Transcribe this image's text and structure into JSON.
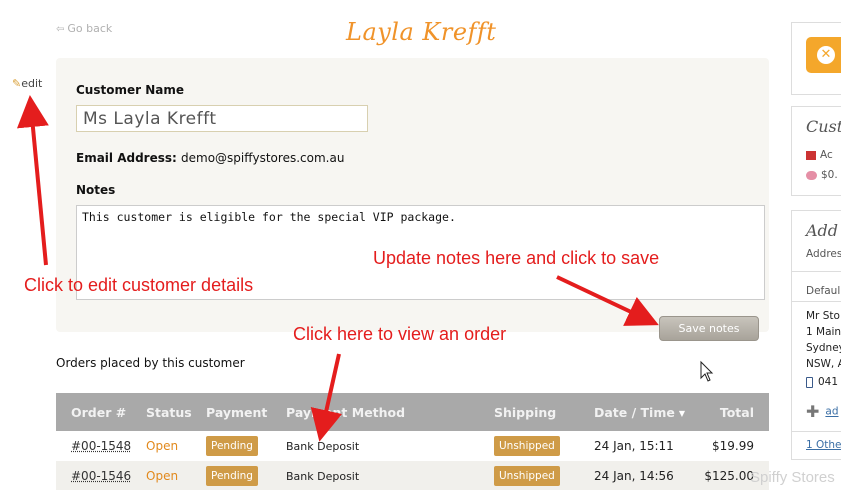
{
  "header": {
    "back_label": "Go back",
    "page_title": "Layla Krefft",
    "edit_label": "edit"
  },
  "customer": {
    "name_label": "Customer Name",
    "name_value": "Ms Layla Krefft",
    "email_label": "Email Address:",
    "email_value": "demo@spiffystores.com.au",
    "notes_label": "Notes",
    "notes_value": "This customer is eligible for the special VIP package.",
    "save_label": "Save notes"
  },
  "annotations": {
    "edit_hint": "Click to edit customer details",
    "notes_hint": "Update notes here and click to save",
    "order_hint": "Click here to view an order"
  },
  "orders": {
    "heading": "Orders placed by this customer",
    "columns": [
      "Order #",
      "Status",
      "Payment",
      "Payment Method",
      "Shipping",
      "Date / Time",
      "Total"
    ],
    "rows": [
      {
        "order": "#00-1548",
        "status": "Open",
        "payment": "Pending",
        "method": "Bank Deposit",
        "shipping": "Unshipped",
        "date": "24 Jan, 15:11",
        "total": "$19.99"
      },
      {
        "order": "#00-1546",
        "status": "Open",
        "payment": "Pending",
        "method": "Bank Deposit",
        "shipping": "Unshipped",
        "date": "24 Jan, 14:56",
        "total": "$125.00"
      }
    ]
  },
  "sidebar": {
    "customer_heading": "Cust",
    "customer_line1": "Ac",
    "customer_line2": "$0.",
    "address_heading": "Add",
    "address_label": "Addres",
    "default_label": "Defaul",
    "address_lines": [
      "Mr Sto",
      "1 Main",
      "Sydney",
      "NSW, A"
    ],
    "phone": "041",
    "add_link": "ad",
    "other_link": "1 Othe"
  },
  "watermark": "Spiffy Stores",
  "colors": {
    "title_orange": "#f0932a",
    "annotation_red": "#e41d1d",
    "badge_tan": "#cf9b47",
    "table_header": "#a9a9a9"
  }
}
